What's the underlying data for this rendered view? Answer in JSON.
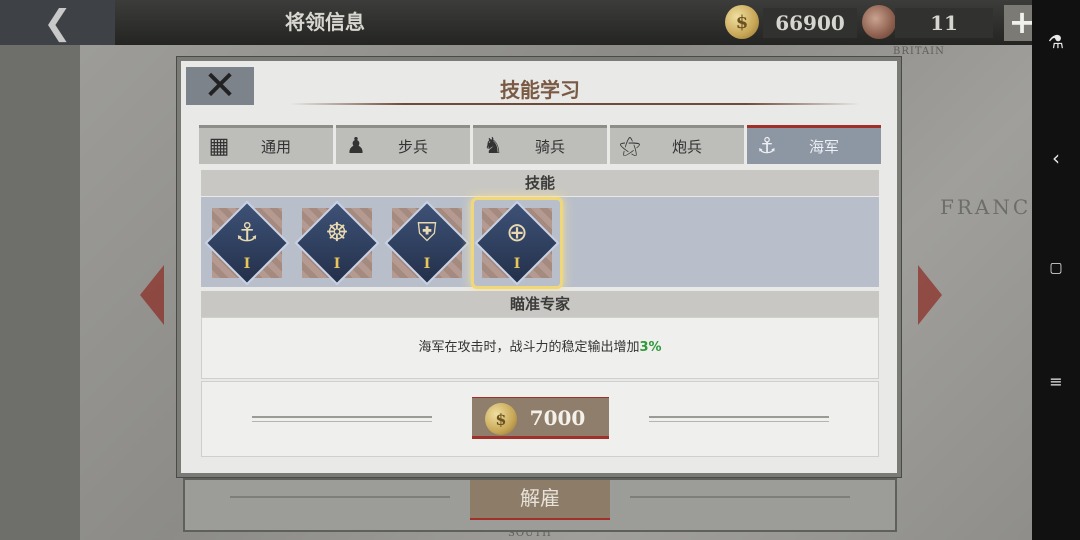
{
  "topbar": {
    "title": "将领信息",
    "gold": "66900",
    "medals": "11",
    "plus_label": "+"
  },
  "background": {
    "map_label": "FRANCE",
    "map_label_top": "BRITAIN",
    "map_label_bottom": "SOUTH",
    "under_button": "解雇"
  },
  "dialog": {
    "title": "技能学习",
    "tabs": [
      {
        "label": "通用",
        "icon": "grid-icon"
      },
      {
        "label": "步兵",
        "icon": "infantry-icon"
      },
      {
        "label": "骑兵",
        "icon": "horse-icon"
      },
      {
        "label": "炮兵",
        "icon": "cannon-icon"
      },
      {
        "label": "海军",
        "icon": "anchor-icon",
        "active": true
      }
    ],
    "skills_header": "技能",
    "skills": [
      {
        "icon": "ship-location-icon",
        "level": "I"
      },
      {
        "icon": "ship-wheel-icon",
        "level": "I"
      },
      {
        "icon": "ship-shield-icon",
        "level": "I"
      },
      {
        "icon": "crosshair-icon",
        "level": "I",
        "selected": true
      }
    ],
    "skill_name": "瞄准专家",
    "description_prefix": "海军在攻击时，战斗力的稳定输出增加",
    "description_value": "3%",
    "cost": "7000"
  },
  "colors": {
    "accent_red": "#a0302a",
    "highlight_green": "#2f9a3a",
    "title_brown": "#7a5a44",
    "active_tab": "#8d96a3"
  }
}
